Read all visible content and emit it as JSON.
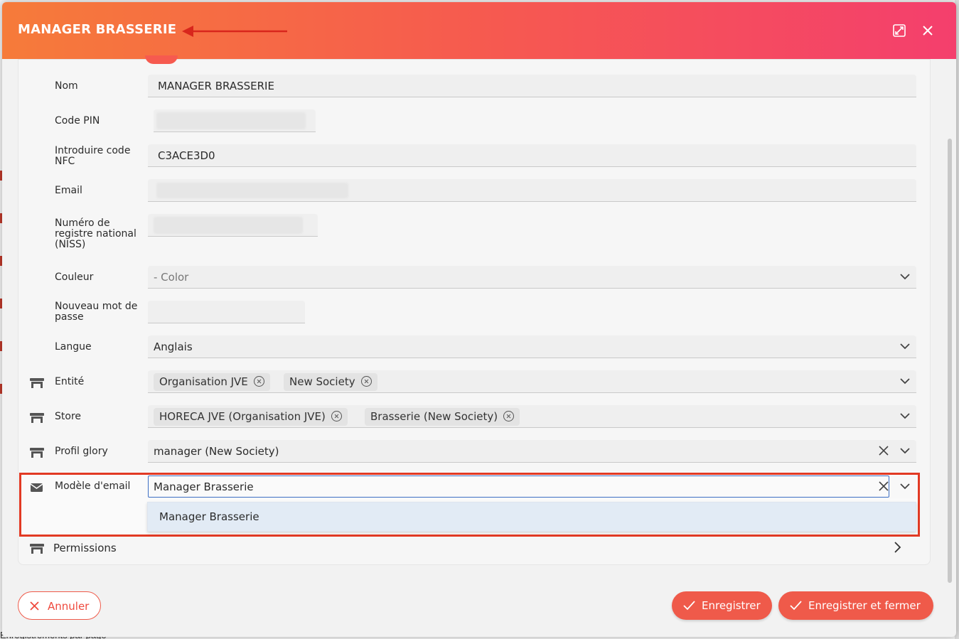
{
  "modal": {
    "title": "MANAGER BRASSERIE",
    "expand_icon": "expand-icon",
    "close_icon": "close-icon"
  },
  "form": {
    "name": {
      "label": "Nom",
      "value": "MANAGER BRASSERIE"
    },
    "pin": {
      "label": "Code PIN"
    },
    "nfc": {
      "label": "Introduire code NFC",
      "value": "C3ACE3D0"
    },
    "email": {
      "label": "Email"
    },
    "niss": {
      "label": "Numéro de registre national (NISS)"
    },
    "color": {
      "label": "Couleur",
      "placeholder": "- Color"
    },
    "password": {
      "label": "Nouveau mot de passe"
    },
    "language": {
      "label": "Langue",
      "value": "Anglais"
    },
    "entity": {
      "label": "Entité",
      "icon": "store-icon",
      "chips": [
        "Organisation JVE",
        "New Society"
      ]
    },
    "store": {
      "label": "Store",
      "icon": "store-icon",
      "chips": [
        "HORECA JVE (Organisation JVE)",
        "Brasserie (New Society)"
      ]
    },
    "profile": {
      "label": "Profil glory",
      "icon": "store-icon",
      "value": "manager (New Society)"
    },
    "email_template": {
      "label": "Modèle d'email",
      "icon": "envelope-icon",
      "value": "Manager Brasserie",
      "options": [
        "Manager Brasserie"
      ]
    }
  },
  "permissions": {
    "label": "Permissions",
    "icon": "store-icon"
  },
  "footer": {
    "cancel_label": "Annuler",
    "save_label": "Enregistrer",
    "save_close_label": "Enregistrer et fermer"
  },
  "background": {
    "partial_text": "Enregistrements par page"
  },
  "colors": {
    "header_start": "#f67b3a",
    "header_end": "#f43f6d",
    "accent": "#ef5a4a",
    "highlight_box": "#e23a24",
    "focus_border": "#3d6fc4"
  }
}
